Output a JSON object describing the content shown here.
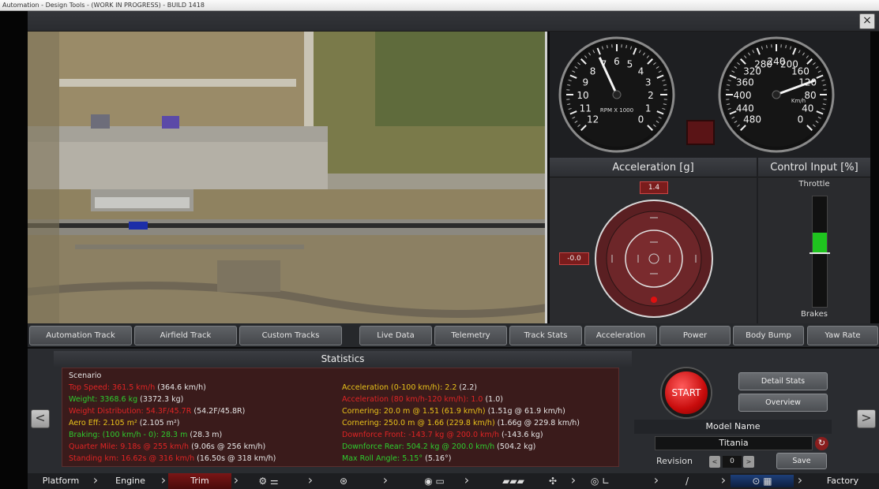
{
  "window": {
    "title": "Automation - Design Tools - (WORK IN PROGRESS) - BUILD 1418",
    "close_label": "×"
  },
  "gauges": {
    "rpm": {
      "ticks": [
        "0",
        "1",
        "2",
        "3",
        "4",
        "5",
        "6",
        "7",
        "8",
        "9",
        "10",
        "11",
        "12"
      ],
      "label": "RPM X 1000"
    },
    "speed": {
      "ticks": [
        "0",
        "40",
        "80",
        "120",
        "160",
        "200",
        "240",
        "280",
        "320",
        "360",
        "400",
        "440",
        "480"
      ],
      "label": "Km/h"
    }
  },
  "acceleration": {
    "title": "Acceleration [g]",
    "long_value": "1.4",
    "lat_value": "-0.0"
  },
  "control_input": {
    "title": "Control Input [%]",
    "throttle_label": "Throttle",
    "brakes_label": "Brakes",
    "throttle_level": 0.35
  },
  "track_tabs": [
    "Automation Track",
    "Airfield Track",
    "Custom Tracks"
  ],
  "data_tabs": [
    "Live Data",
    "Telemetry",
    "Track Stats",
    "Acceleration",
    "Power",
    "Body Bump",
    "Yaw Rate"
  ],
  "statistics": {
    "title": "Statistics",
    "scenario": "Scenario",
    "left": [
      {
        "label": "Top Speed: 361.5 km/h",
        "extra": "(364.6 km/h)",
        "color": "red"
      },
      {
        "label": "Weight: 3368.6 kg",
        "extra": "(3372.3 kg)",
        "color": "grn"
      },
      {
        "label": "Weight Distribution: 54.3F/45.7R",
        "extra": "(54.2F/45.8R)",
        "color": "red"
      },
      {
        "label": "Aero Eff: 2.105 m²",
        "extra": "(2.105 m²)",
        "color": "yel"
      },
      {
        "label": "Braking: (100 km/h - 0): 28.3 m",
        "extra": "(28.3 m)",
        "color": "grn"
      },
      {
        "label": "Quarter Mile: 9.18s @ 255 km/h",
        "extra": "(9.06s @ 256 km/h)",
        "color": "red"
      },
      {
        "label": "Standing km: 16.62s @ 316 km/h",
        "extra": "(16.50s @ 318 km/h)",
        "color": "red"
      }
    ],
    "right": [
      {
        "label": "Acceleration (0-100 km/h): 2.2",
        "extra": "(2.2)",
        "color": "yel"
      },
      {
        "label": "Acceleration (80 km/h-120 km/h): 1.0",
        "extra": "(1.0)",
        "color": "red"
      },
      {
        "label": "Cornering: 20.0 m @ 1.51 (61.9 km/h)",
        "extra": "(1.51g @ 61.9 km/h)",
        "color": "yel"
      },
      {
        "label": "Cornering: 250.0 m @ 1.66 (229.8 km/h)",
        "extra": "(1.66g @ 229.8 km/h)",
        "color": "yel"
      },
      {
        "label": "Downforce Front: -143.7 kg @ 200.0 km/h",
        "extra": "(-143.6 kg)",
        "color": "red"
      },
      {
        "label": "Downforce Rear: 504.2 kg @ 200.0 km/h",
        "extra": "(504.2 kg)",
        "color": "grn"
      },
      {
        "label": "Max Roll Angle: 5.15°",
        "extra": "(5.16°)",
        "color": "grn"
      }
    ]
  },
  "controls": {
    "start_label": "START",
    "detail_stats_label": "Detail Stats",
    "overview_label": "Overview",
    "model_name_title": "Model Name",
    "model_name_value": "Titania",
    "revision_label": "Revision",
    "revision_value": "0",
    "save_label": "Save",
    "prev_label": "<",
    "next_label": ">",
    "dec_label": "<",
    "inc_label": ">"
  },
  "nav": {
    "platform": "Platform",
    "engine": "Engine",
    "trim": "Trim",
    "factory": "Factory"
  },
  "colors": {
    "accent_red": "#c80c0c",
    "stat_red": "#e02424",
    "stat_green": "#2ecc2e",
    "stat_yellow": "#e8c21b"
  }
}
